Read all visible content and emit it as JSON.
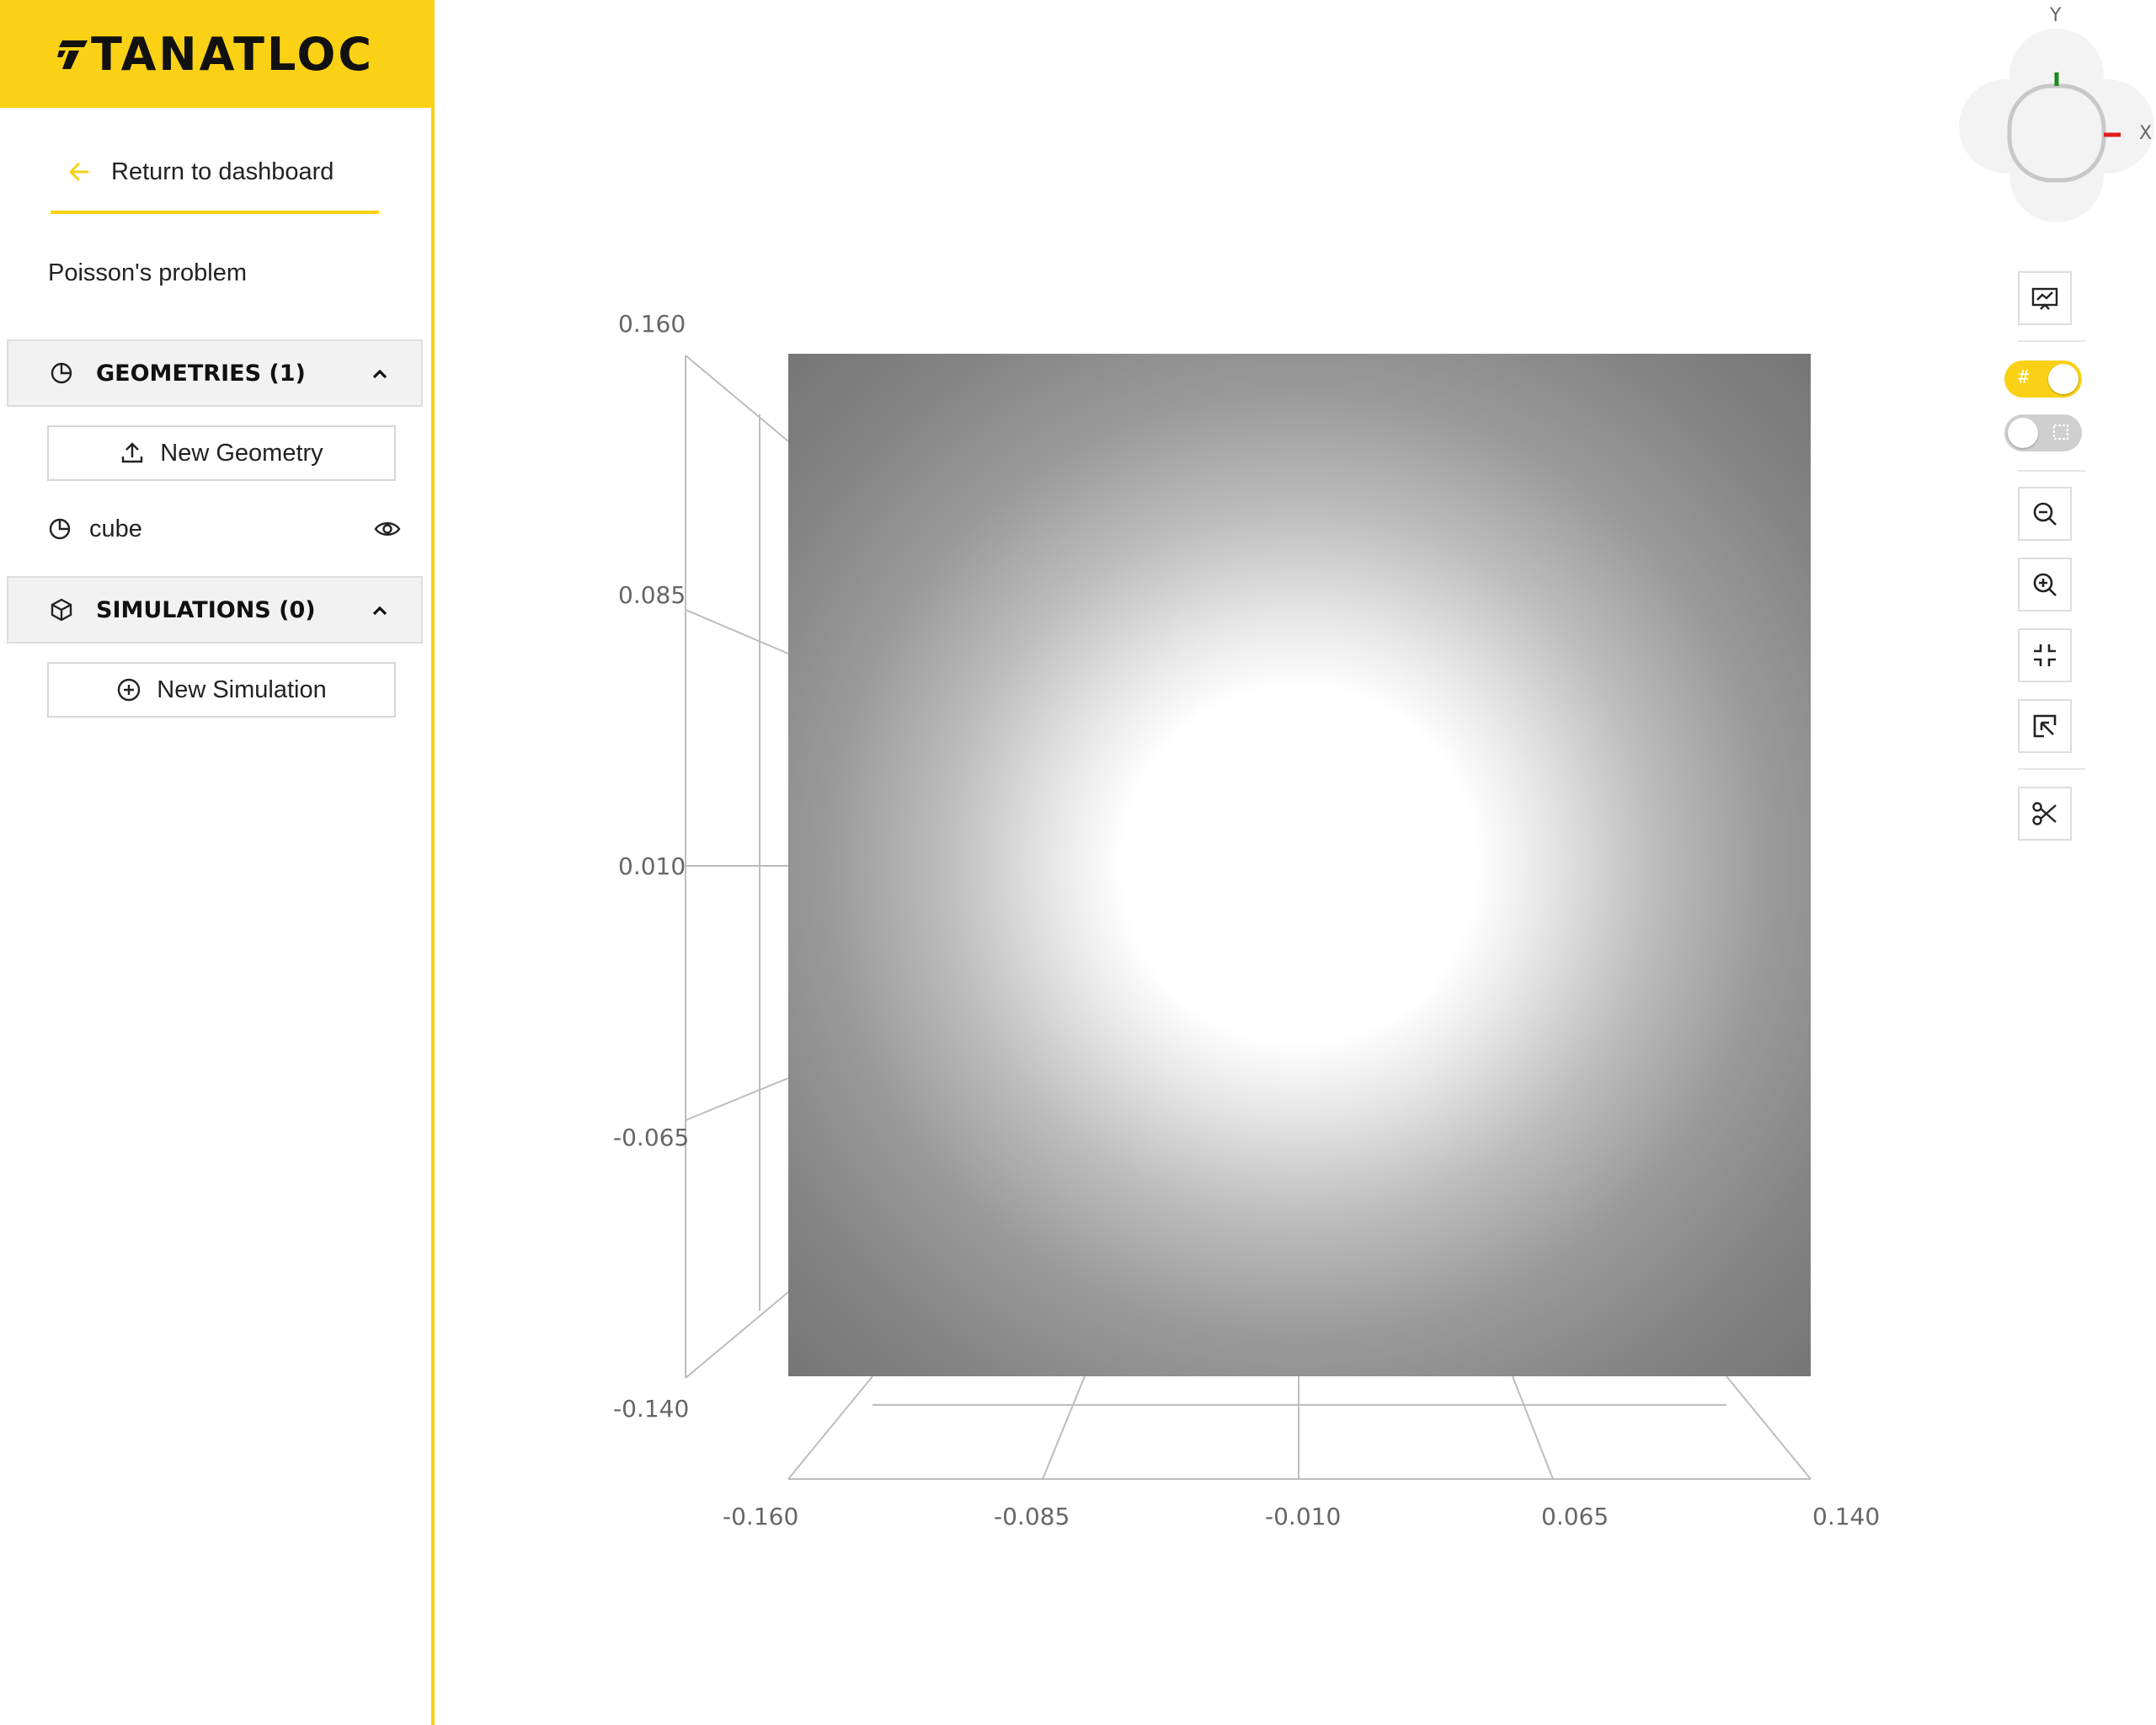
{
  "brand": {
    "name": "TANATLOC",
    "color": "#fad114"
  },
  "sidebar": {
    "return_label": "Return to dashboard",
    "project_title": "Poisson's problem",
    "geometries": {
      "title": "GEOMETRIES (1)",
      "new_button": "New Geometry",
      "items": [
        {
          "label": "cube",
          "icon": "pie-chart-icon",
          "visible": true
        }
      ]
    },
    "simulations": {
      "title": "SIMULATIONS (0)",
      "new_button": "New Simulation"
    }
  },
  "viewport": {
    "gizmo": {
      "y_label": "Y",
      "x_label": "X"
    },
    "y_ticks": [
      "0.160",
      "0.085",
      "0.010",
      "-0.065",
      "-0.140"
    ],
    "x_ticks": [
      "-0.160",
      "-0.085",
      "-0.010",
      "0.065",
      "0.140"
    ],
    "toggles": [
      {
        "name": "grid-toggle",
        "on": true
      },
      {
        "name": "transparency-toggle",
        "on": false
      }
    ],
    "tools": [
      "screenshot-icon",
      "zoom-out-icon",
      "zoom-in-icon",
      "zoom-to-fit-icon",
      "zoom-to-selection-icon",
      "section-cut-icon"
    ]
  }
}
